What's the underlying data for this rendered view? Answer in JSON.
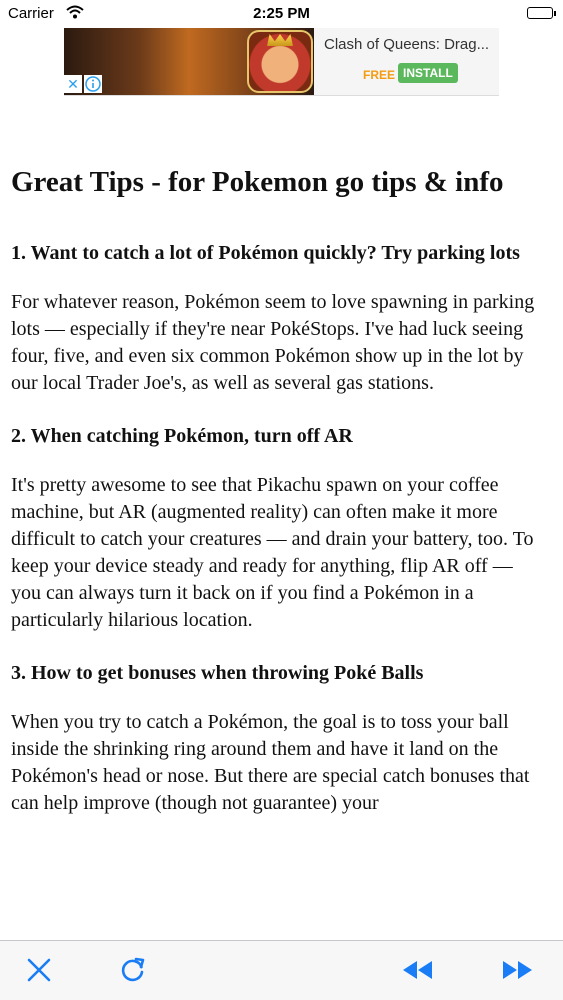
{
  "status_bar": {
    "carrier": "Carrier",
    "time": "2:25 PM"
  },
  "ad": {
    "title": "Clash of Queens: Drag...",
    "free_label": "FREE",
    "install_label": "INSTALL"
  },
  "article": {
    "title": "Great Tips - for Pokemon go tips & info",
    "sections": [
      {
        "heading": "1. Want to catch a lot of Pokémon quickly? Try parking lots",
        "body": "For whatever reason, Pokémon seem to love spawning in parking lots — especially if they're near PokéStops. I've had luck seeing four, five, and even six common Pokémon show up in the lot by our local Trader Joe's, as well as several gas stations."
      },
      {
        "heading": "2. When catching Pokémon, turn off AR",
        "body": "It's pretty awesome to see that Pikachu spawn on your coffee machine, but AR (augmented reality) can often make it more difficult to catch your creatures — and drain your battery, too. To keep your device steady and ready for anything, flip AR off — you can always turn it back on if you find a Pokémon in a particularly hilarious location."
      },
      {
        "heading": "3. How to get bonuses when throwing Poké Balls",
        "body": "When you try to catch a Pokémon, the goal is to toss your ball inside the shrinking ring around them and have it land on the Pokémon's head or nose. But there are special catch bonuses that can help improve (though not guarantee) your"
      }
    ]
  },
  "toolbar": {
    "icons": [
      "close-icon",
      "refresh-icon",
      "rewind-icon",
      "fast-forward-icon"
    ],
    "accent_color": "#1a7df5"
  }
}
